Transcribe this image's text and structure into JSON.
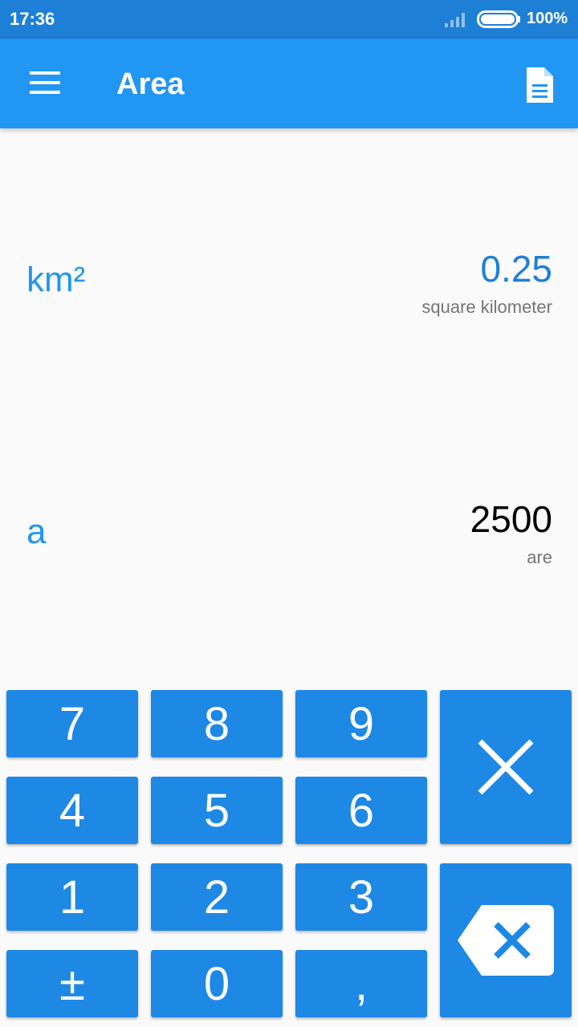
{
  "status_bar": {
    "time": "17:36",
    "battery": "100%",
    "signal_icon": "signal-icon",
    "battery_icon": "battery-icon"
  },
  "app_bar": {
    "title": "Area",
    "menu_icon": "menu-icon",
    "document_icon": "document-icon"
  },
  "units": [
    {
      "symbol": "km²",
      "value": "0.25",
      "name": "square kilometer",
      "active": true
    },
    {
      "symbol": "a",
      "value": "2500",
      "name": "are",
      "active": false
    }
  ],
  "keypad": {
    "digits": [
      "7",
      "8",
      "9",
      "4",
      "5",
      "6",
      "1",
      "2",
      "3"
    ],
    "plus_minus": "±",
    "zero": "0",
    "decimal": ",",
    "clear_icon": "close-icon",
    "backspace_icon": "backspace-icon"
  },
  "colors": {
    "status_bar": "#1e7fd6",
    "app_bar": "#2196f3",
    "accent": "#2196f3",
    "active_value": "#1e7fd6",
    "key": "#1e88e5"
  }
}
